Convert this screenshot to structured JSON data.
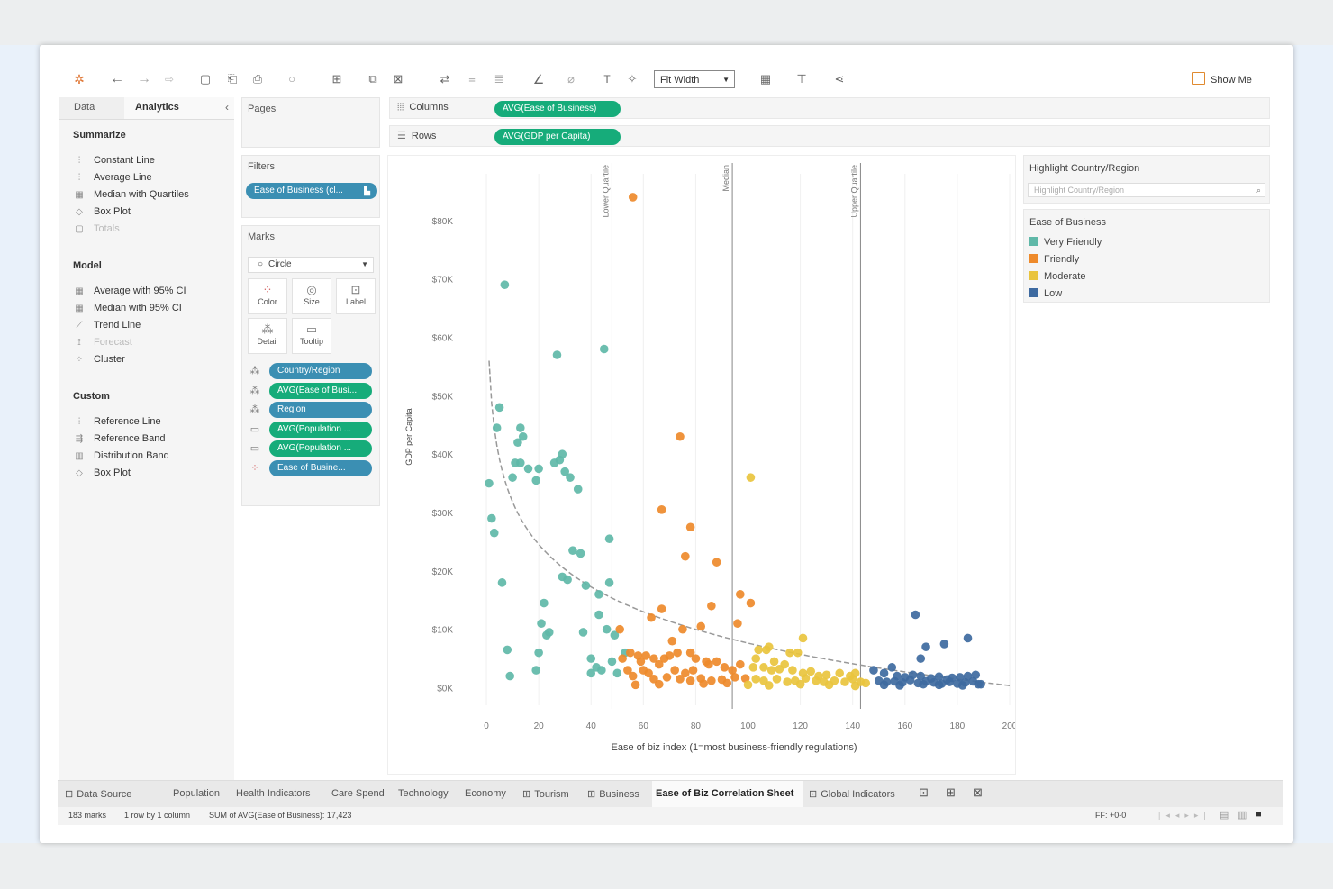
{
  "toolbar": {
    "fit_label": "Fit Width",
    "show_me_label": "Show Me"
  },
  "left_pane": {
    "tabs": [
      "Data",
      "Analytics"
    ],
    "sections": [
      {
        "title": "Summarize",
        "items": [
          {
            "label": "Constant Line",
            "icon": "chart-icon"
          },
          {
            "label": "Average Line",
            "icon": "chart-icon"
          },
          {
            "label": "Median with Quartiles",
            "icon": "table-icon"
          },
          {
            "label": "Box Plot",
            "icon": "boxplot-icon"
          },
          {
            "label": "Totals",
            "icon": "totals-icon",
            "disabled": true
          }
        ]
      },
      {
        "title": "Model",
        "items": [
          {
            "label": "Average with 95% CI",
            "icon": "table-icon"
          },
          {
            "label": "Median with 95% CI",
            "icon": "table-icon"
          },
          {
            "label": "Trend Line",
            "icon": "trend-icon"
          },
          {
            "label": "Forecast",
            "icon": "forecast-icon",
            "disabled": true
          },
          {
            "label": "Cluster",
            "icon": "cluster-icon"
          }
        ]
      },
      {
        "title": "Custom",
        "items": [
          {
            "label": "Reference Line",
            "icon": "chart-icon"
          },
          {
            "label": "Reference Band",
            "icon": "band-icon"
          },
          {
            "label": "Distribution Band",
            "icon": "distribution-icon"
          },
          {
            "label": "Box Plot",
            "icon": "boxplot-icon"
          }
        ]
      }
    ]
  },
  "pages": {
    "title": "Pages"
  },
  "filters": {
    "title": "Filters",
    "pills": [
      "Ease of Business (cl..."
    ]
  },
  "marks": {
    "title": "Marks",
    "mark_type": "Circle",
    "buttons": [
      "Color",
      "Size",
      "Label",
      "Detail",
      "Tooltip"
    ],
    "fields": [
      {
        "label": "Country/Region",
        "color": "blue"
      },
      {
        "label": "AVG(Ease of Busi...",
        "color": "green"
      },
      {
        "label": "Region",
        "color": "blue"
      },
      {
        "label": "AVG(Population ...",
        "color": "green"
      },
      {
        "label": "AVG(Population ...",
        "color": "green"
      },
      {
        "label": "Ease of Busine...",
        "color": "blue"
      }
    ]
  },
  "shelves": {
    "columns_label": "Columns",
    "columns_pill": "AVG(Ease of Business)",
    "rows_label": "Rows",
    "rows_pill": "AVG(GDP per Capita)"
  },
  "highlight": {
    "title": "Highlight Country/Region",
    "placeholder": "Highlight Country/Region"
  },
  "legend": {
    "title": "Ease of Business",
    "items": [
      {
        "label": "Very Friendly",
        "color": "#5fb8a8"
      },
      {
        "label": "Friendly",
        "color": "#ee8a2b"
      },
      {
        "label": "Moderate",
        "color": "#e9c43e"
      },
      {
        "label": "Low",
        "color": "#3e6aa0"
      }
    ]
  },
  "chart_data": {
    "type": "scatter",
    "xlabel": "Ease of biz index (1=most business-friendly regulations)",
    "ylabel": "GDP per Capita",
    "xlim": [
      -10,
      200
    ],
    "ylim": [
      -3000,
      88000
    ],
    "x_ticks": [
      "0",
      "20",
      "40",
      "60",
      "80",
      "100",
      "120",
      "140",
      "160",
      "180",
      "200"
    ],
    "y_ticks": [
      "$0K",
      "$10K",
      "$20K",
      "$30K",
      "$40K",
      "$50K",
      "$60K",
      "$70K",
      "$80K"
    ],
    "reference_lines": [
      {
        "label": "Lower Quartile",
        "x": 48
      },
      {
        "label": "Median",
        "x": 94
      },
      {
        "label": "Upper Quartile",
        "x": 143
      }
    ],
    "trend": "logarithmic",
    "series": [
      {
        "name": "Very Friendly",
        "color": "#5fb8a8",
        "points": [
          [
            7,
            69000
          ],
          [
            27,
            57000
          ],
          [
            45,
            58000
          ],
          [
            5,
            48000
          ],
          [
            4,
            44500
          ],
          [
            13,
            44500
          ],
          [
            14,
            43000
          ],
          [
            12,
            42000
          ],
          [
            11,
            38500
          ],
          [
            13,
            38500
          ],
          [
            10,
            36000
          ],
          [
            16,
            37500
          ],
          [
            20,
            37500
          ],
          [
            26,
            38500
          ],
          [
            29,
            40000
          ],
          [
            28,
            39000
          ],
          [
            30,
            37000
          ],
          [
            32,
            36000
          ],
          [
            35,
            34000
          ],
          [
            19,
            35500
          ],
          [
            1,
            35000
          ],
          [
            2,
            29000
          ],
          [
            3,
            26500
          ],
          [
            6,
            18000
          ],
          [
            33,
            23500
          ],
          [
            36,
            23000
          ],
          [
            47,
            25500
          ],
          [
            29,
            19000
          ],
          [
            31,
            18500
          ],
          [
            38,
            17500
          ],
          [
            43,
            16000
          ],
          [
            47,
            18000
          ],
          [
            22,
            14500
          ],
          [
            21,
            11000
          ],
          [
            24,
            9500
          ],
          [
            23,
            9000
          ],
          [
            37,
            9500
          ],
          [
            43,
            12500
          ],
          [
            46,
            10000
          ],
          [
            49,
            9000
          ],
          [
            8,
            6500
          ],
          [
            20,
            6000
          ],
          [
            40,
            5000
          ],
          [
            42,
            3500
          ],
          [
            44,
            3000
          ],
          [
            48,
            4500
          ],
          [
            19,
            3000
          ],
          [
            9,
            2000
          ],
          [
            40,
            2500
          ],
          [
            53,
            6000
          ],
          [
            50,
            2500
          ]
        ]
      },
      {
        "name": "Friendly",
        "color": "#ee8a2b",
        "points": [
          [
            56,
            84000
          ],
          [
            74,
            43000
          ],
          [
            67,
            30500
          ],
          [
            78,
            27500
          ],
          [
            76,
            22500
          ],
          [
            88,
            21500
          ],
          [
            97,
            16000
          ],
          [
            51,
            10000
          ],
          [
            63,
            12000
          ],
          [
            67,
            13500
          ],
          [
            86,
            14000
          ],
          [
            101,
            14500
          ],
          [
            75,
            10000
          ],
          [
            82,
            10500
          ],
          [
            96,
            11000
          ],
          [
            71,
            8000
          ],
          [
            55,
            6000
          ],
          [
            58,
            5500
          ],
          [
            61,
            5500
          ],
          [
            64,
            5000
          ],
          [
            68,
            5000
          ],
          [
            70,
            5500
          ],
          [
            73,
            6000
          ],
          [
            78,
            6000
          ],
          [
            52,
            5000
          ],
          [
            59,
            4500
          ],
          [
            66,
            4000
          ],
          [
            80,
            5000
          ],
          [
            84,
            4500
          ],
          [
            54,
            3000
          ],
          [
            60,
            3000
          ],
          [
            62,
            2500
          ],
          [
            72,
            3000
          ],
          [
            76,
            2500
          ],
          [
            79,
            3000
          ],
          [
            85,
            4000
          ],
          [
            88,
            4500
          ],
          [
            91,
            3500
          ],
          [
            94,
            3000
          ],
          [
            97,
            4000
          ],
          [
            56,
            2000
          ],
          [
            64,
            1500
          ],
          [
            69,
            1800
          ],
          [
            74,
            1500
          ],
          [
            78,
            1200
          ],
          [
            82,
            1600
          ],
          [
            86,
            1200
          ],
          [
            90,
            1400
          ],
          [
            95,
            1800
          ],
          [
            99,
            1600
          ],
          [
            57,
            500
          ],
          [
            66,
            600
          ],
          [
            83,
            700
          ],
          [
            92,
            800
          ]
        ]
      },
      {
        "name": "Moderate",
        "color": "#e9c43e",
        "points": [
          [
            101,
            36000
          ],
          [
            121,
            8500
          ],
          [
            104,
            6500
          ],
          [
            107,
            6500
          ],
          [
            108,
            7000
          ],
          [
            116,
            6000
          ],
          [
            119,
            6000
          ],
          [
            103,
            5000
          ],
          [
            110,
            4500
          ],
          [
            114,
            4000
          ],
          [
            102,
            3500
          ],
          [
            106,
            3500
          ],
          [
            109,
            3000
          ],
          [
            112,
            3200
          ],
          [
            117,
            3000
          ],
          [
            121,
            2500
          ],
          [
            124,
            2800
          ],
          [
            127,
            2000
          ],
          [
            130,
            2200
          ],
          [
            135,
            2500
          ],
          [
            139,
            2000
          ],
          [
            141,
            2500
          ],
          [
            103,
            1500
          ],
          [
            106,
            1200
          ],
          [
            111,
            1500
          ],
          [
            115,
            1000
          ],
          [
            118,
            1200
          ],
          [
            122,
            1600
          ],
          [
            126,
            1200
          ],
          [
            129,
            1000
          ],
          [
            133,
            1200
          ],
          [
            137,
            1000
          ],
          [
            140,
            1500
          ],
          [
            143,
            1000
          ],
          [
            145,
            800
          ],
          [
            100,
            500
          ],
          [
            108,
            400
          ],
          [
            120,
            600
          ],
          [
            131,
            500
          ],
          [
            141,
            300
          ]
        ]
      },
      {
        "name": "Low",
        "color": "#3e6aa0",
        "points": [
          [
            164,
            12500
          ],
          [
            168,
            7000
          ],
          [
            175,
            7500
          ],
          [
            184,
            8500
          ],
          [
            166,
            5000
          ],
          [
            148,
            3000
          ],
          [
            152,
            2500
          ],
          [
            155,
            3500
          ],
          [
            157,
            2000
          ],
          [
            160,
            1800
          ],
          [
            163,
            2200
          ],
          [
            166,
            2000
          ],
          [
            170,
            1600
          ],
          [
            173,
            1900
          ],
          [
            176,
            1400
          ],
          [
            178,
            1700
          ],
          [
            181,
            1800
          ],
          [
            184,
            2000
          ],
          [
            187,
            2200
          ],
          [
            150,
            1200
          ],
          [
            153,
            1000
          ],
          [
            156,
            1100
          ],
          [
            159,
            900
          ],
          [
            162,
            1300
          ],
          [
            165,
            800
          ],
          [
            168,
            1100
          ],
          [
            171,
            900
          ],
          [
            174,
            700
          ],
          [
            177,
            1000
          ],
          [
            180,
            700
          ],
          [
            183,
            900
          ],
          [
            186,
            1100
          ],
          [
            189,
            600
          ],
          [
            152,
            500
          ],
          [
            158,
            400
          ],
          [
            167,
            600
          ],
          [
            173,
            500
          ],
          [
            182,
            400
          ],
          [
            188,
            600
          ]
        ]
      }
    ]
  },
  "sheet_tabs": {
    "data_source": "Data Source",
    "tabs": [
      "Population",
      "Health Indicators",
      "Care Spend",
      "Technology",
      "Economy",
      "Tourism",
      "Business",
      "Ease of Biz Correlation Sheet",
      "Global Indicators"
    ]
  },
  "status": {
    "marks": "183 marks",
    "dims": "1 row by 1 column",
    "sum": "SUM of AVG(Ease of Business): 17,423",
    "ff": "FF: +0-0"
  }
}
